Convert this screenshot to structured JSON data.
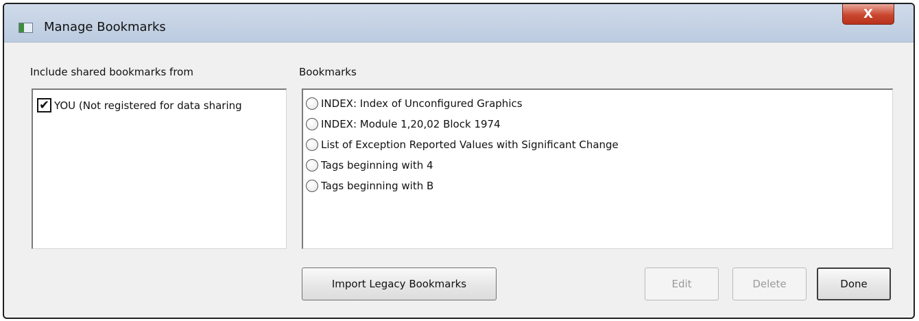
{
  "window": {
    "title": "Manage Bookmarks",
    "close_label": "X"
  },
  "shared": {
    "label": "Include shared bookmarks from",
    "items": [
      {
        "label": "YOU (Not registered for data sharing",
        "checked": true,
        "check_glyph": "✔"
      }
    ]
  },
  "bookmarks": {
    "label": "Bookmarks",
    "items": [
      {
        "label": "INDEX: Index of Unconfigured Graphics"
      },
      {
        "label": "INDEX: Module 1,20,02 Block 1974"
      },
      {
        "label": "List of Exception Reported Values with Significant Change"
      },
      {
        "label": "Tags beginning with 4"
      },
      {
        "label": "Tags beginning with B"
      }
    ]
  },
  "buttons": {
    "import": "Import Legacy Bookmarks",
    "edit": "Edit",
    "delete": "Delete",
    "done": "Done"
  },
  "colors": {
    "close_button": "#c9462f",
    "dialog_background": "#f0f0f0",
    "titlebar": "#c5d3e6"
  }
}
